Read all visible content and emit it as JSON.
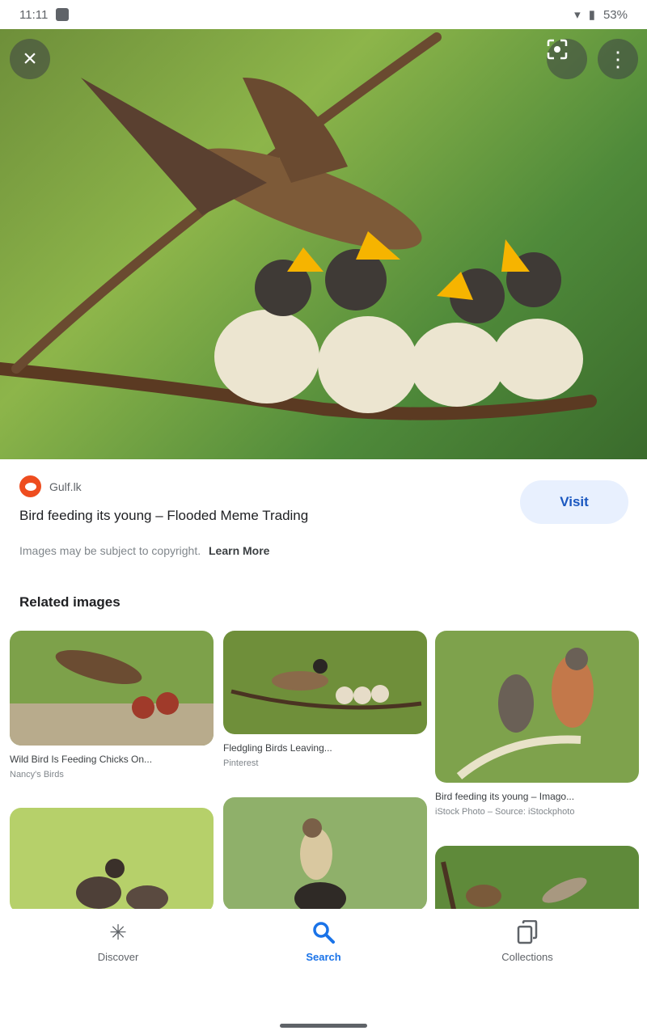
{
  "status_bar": {
    "time": "11:11",
    "battery": "53%"
  },
  "colors": {
    "accent": "#1a73e8",
    "visit_bg": "#e8f0fe",
    "source_logo": "#ee4d1f"
  },
  "icons": {
    "close": "close-icon",
    "lens": "lens-icon",
    "more": "more-vert-icon",
    "discover": "asterisk-icon",
    "search": "search-icon",
    "collections": "collections-icon"
  },
  "result": {
    "source": "Gulf.lk",
    "title": "Bird feeding its young – Flooded Meme Trading",
    "visit_label": "Visit",
    "copyright_text": "Images may be subject to copyright.",
    "learn_more": "Learn More"
  },
  "related": {
    "heading": "Related images",
    "items": [
      {
        "caption": "Wild Bird Is Feeding Chicks On...",
        "source": "Nancy's Birds"
      },
      {
        "caption": "Fledgling Birds Leaving...",
        "source": "Pinterest"
      },
      {
        "caption": "Bird feeding its young – Imago...",
        "source": "iStock Photo – Source: iStockphoto"
      },
      {
        "caption": "",
        "source": ""
      },
      {
        "caption": "",
        "source": ""
      },
      {
        "caption": "",
        "source": ""
      }
    ]
  },
  "nav": {
    "items": [
      "Discover",
      "Search",
      "Collections"
    ],
    "active": "Search"
  }
}
